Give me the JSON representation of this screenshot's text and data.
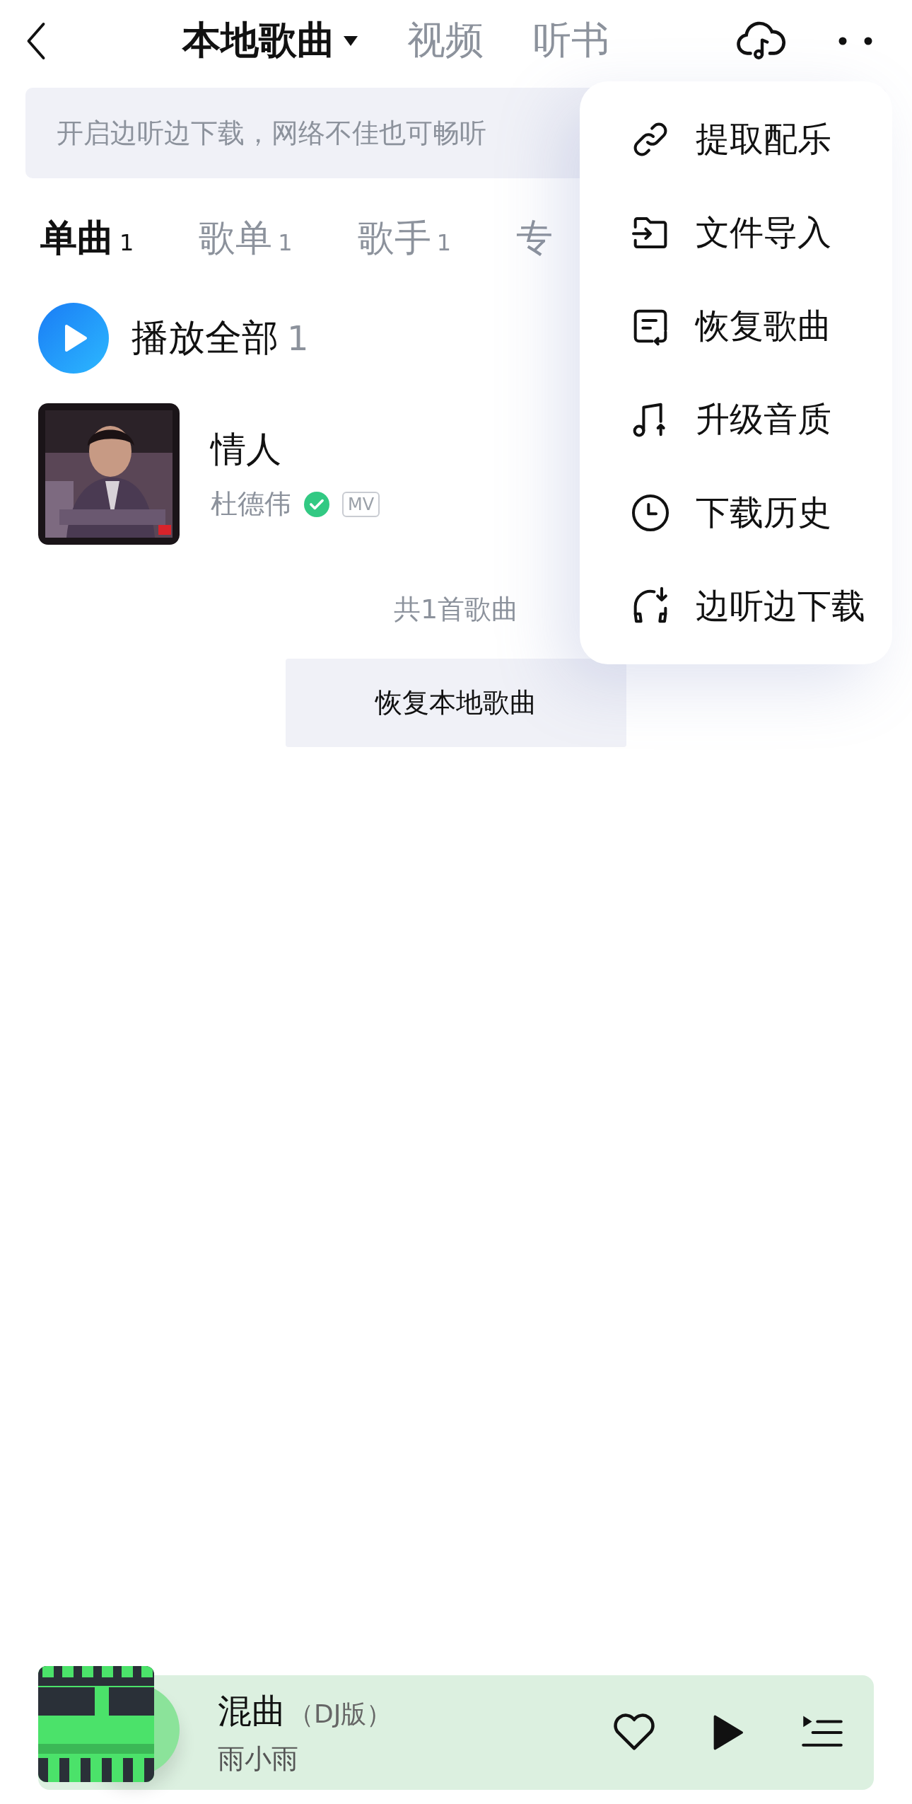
{
  "header": {
    "tabs": [
      {
        "label": "本地歌曲",
        "selected": true,
        "dropdown": true
      },
      {
        "label": "视频",
        "selected": false,
        "dropdown": false
      },
      {
        "label": "听书",
        "selected": false,
        "dropdown": false
      }
    ]
  },
  "banner": {
    "text": "开启边听边下载，网络不佳也可畅听"
  },
  "category_tabs": [
    {
      "label": "单曲",
      "count": "1",
      "selected": true
    },
    {
      "label": "歌单",
      "count": "1",
      "selected": false
    },
    {
      "label": "歌手",
      "count": "1",
      "selected": false
    },
    {
      "label": "专",
      "selected": false
    }
  ],
  "play_all": {
    "label": "播放全部",
    "count": "1"
  },
  "songs": [
    {
      "title": "情人",
      "artist": "杜德伟",
      "verified": true,
      "badge": "MV"
    }
  ],
  "summary": "共1首歌曲",
  "restore_button": "恢复本地歌曲",
  "menu": {
    "items": [
      {
        "kind": "link",
        "label": "提取配乐"
      },
      {
        "kind": "import",
        "label": "文件导入"
      },
      {
        "kind": "restore",
        "label": "恢复歌曲"
      },
      {
        "kind": "quality",
        "label": "升级音质"
      },
      {
        "kind": "history",
        "label": "下载历史"
      },
      {
        "kind": "cache",
        "label": "边听边下载"
      }
    ]
  },
  "player": {
    "title": "混曲",
    "tag": "（DJ版）",
    "artist": "雨小雨",
    "liked": false,
    "playing": false
  }
}
